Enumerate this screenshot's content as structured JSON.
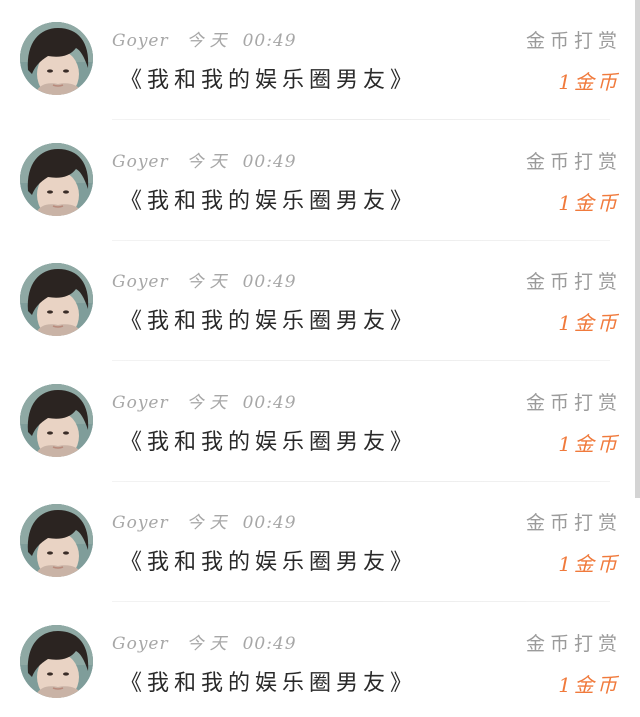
{
  "comments": [
    {
      "author": "Goyer",
      "day": "今天",
      "time": "00:49",
      "title": "《我和我的娱乐圈男友》",
      "reward_label": "金币打赏",
      "coin_amount": "1金币",
      "avatar": "user-avatar-icon"
    },
    {
      "author": "Goyer",
      "day": "今天",
      "time": "00:49",
      "title": "《我和我的娱乐圈男友》",
      "reward_label": "金币打赏",
      "coin_amount": "1金币",
      "avatar": "user-avatar-icon"
    },
    {
      "author": "Goyer",
      "day": "今天",
      "time": "00:49",
      "title": "《我和我的娱乐圈男友》",
      "reward_label": "金币打赏",
      "coin_amount": "1金币",
      "avatar": "user-avatar-icon"
    },
    {
      "author": "Goyer",
      "day": "今天",
      "time": "00:49",
      "title": "《我和我的娱乐圈男友》",
      "reward_label": "金币打赏",
      "coin_amount": "1金币",
      "avatar": "user-avatar-icon"
    },
    {
      "author": "Goyer",
      "day": "今天",
      "time": "00:49",
      "title": "《我和我的娱乐圈男友》",
      "reward_label": "金币打赏",
      "coin_amount": "1金币",
      "avatar": "user-avatar-icon"
    },
    {
      "author": "Goyer",
      "day": "今天",
      "time": "00:49",
      "title": "《我和我的娱乐圈男友》",
      "reward_label": "金币打赏",
      "coin_amount": "1金币",
      "avatar": "user-avatar-icon"
    }
  ],
  "colors": {
    "meta_text": "#a7a7a7",
    "title_text": "#2a2a2a",
    "reward_text": "#9b9b9b",
    "coin_accent": "#f07a3c",
    "avatar_bg": "#7f9d9a",
    "hair": "#2b2421",
    "skin": "#e9d3c4"
  }
}
